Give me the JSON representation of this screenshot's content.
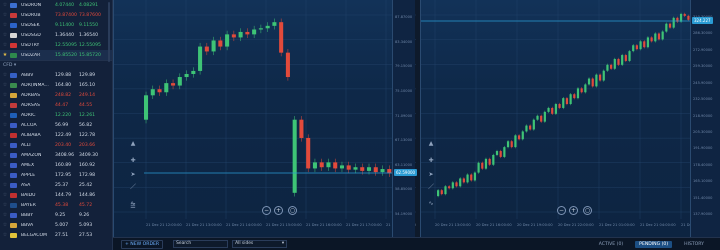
{
  "sidebar": {
    "forex": [
      {
        "sym": "USDRON",
        "bid": "4.07440",
        "ask": "4.08291",
        "dir": "up",
        "flag": "#3c6fd0",
        "fav": false,
        "sel": false
      },
      {
        "sym": "USDRUB",
        "bid": "73.87400",
        "ask": "73.87600",
        "dir": "down",
        "flag": "#c93a3a",
        "fav": false,
        "sel": false
      },
      {
        "sym": "USDSEK",
        "bid": "9.11400",
        "ask": "9.11550",
        "dir": "up",
        "flag": "#2c63c9",
        "fav": false,
        "sel": false
      },
      {
        "sym": "USDSGD",
        "bid": "1.36440",
        "ask": "1.36540",
        "dir": "neutral",
        "flag": "#d6d6d6",
        "fav": false,
        "sel": false
      },
      {
        "sym": "USDTRY",
        "bid": "12.55095",
        "ask": "12.55095",
        "dir": "up",
        "flag": "#d03535",
        "fav": false,
        "sel": false
      },
      {
        "sym": "USDZAR",
        "bid": "15.85520",
        "ask": "15.85720",
        "dir": "up",
        "flag": "#2e8a4d",
        "fav": true,
        "sel": true
      }
    ],
    "cfd_label": "CFD",
    "cfd": [
      {
        "sym": "ABBV",
        "bid": "129.88",
        "ask": "129.89",
        "dir": "neutral",
        "flag": "#3660c4"
      },
      {
        "sym": "ADR(INMA...",
        "bid": "164.80",
        "ask": "165.10",
        "dir": "neutral",
        "flag": "#3a8c4e"
      },
      {
        "sym": "ADRBAS",
        "bid": "248.82",
        "ask": "249.14",
        "dir": "down",
        "flag": "#d4a53a"
      },
      {
        "sym": "ADRSAS",
        "bid": "44.47",
        "ask": "44.55",
        "dir": "down",
        "flag": "#c23b3b"
      },
      {
        "sym": "ADRIC",
        "bid": "12.220",
        "ask": "12.261",
        "dir": "up",
        "flag": "#1f5fb8"
      },
      {
        "sym": "ALCOA",
        "bid": "56.99",
        "ask": "56.82",
        "dir": "neutral",
        "flag": "#3b5cc4"
      },
      {
        "sym": "ALIBABA",
        "bid": "122.49",
        "ask": "122.78",
        "dir": "neutral",
        "flag": "#c13030"
      },
      {
        "sym": "ALLI",
        "bid": "203.40",
        "ask": "203.66",
        "dir": "down",
        "flag": "#3b5cc4"
      },
      {
        "sym": "AMAZON",
        "bid": "3408.96",
        "ask": "3409.30",
        "dir": "neutral",
        "flag": "#3b5cc4"
      },
      {
        "sym": "AMEX",
        "bid": "160.89",
        "ask": "160.92",
        "dir": "neutral",
        "flag": "#3b5cc4"
      },
      {
        "sym": "APPLE",
        "bid": "172.95",
        "ask": "172.98",
        "dir": "neutral",
        "flag": "#3b5cc4"
      },
      {
        "sym": "ASA",
        "bid": "25.37",
        "ask": "25.42",
        "dir": "neutral",
        "flag": "#3b5cc4"
      },
      {
        "sym": "BAIDU",
        "bid": "144.79",
        "ask": "144.86",
        "dir": "neutral",
        "flag": "#c13030"
      },
      {
        "sym": "BAYER",
        "bid": "45.38",
        "ask": "45.72",
        "dir": "down",
        "flag": "#1f4e8c"
      },
      {
        "sym": "BBBY",
        "bid": "9.25",
        "ask": "9.26",
        "dir": "neutral",
        "flag": "#3b5cc4"
      },
      {
        "sym": "BBVA",
        "bid": "5.007",
        "ask": "5.093",
        "dir": "neutral",
        "flag": "#d4a53a"
      },
      {
        "sym": "BELGACOM",
        "bid": "27.51",
        "ask": "27.53",
        "dir": "neutral",
        "flag": "#e0c23a"
      }
    ]
  },
  "chart_data": [
    {
      "type": "candlestick",
      "title": "",
      "y_ticks": [
        "87.87000",
        "83.34000",
        "79.15000",
        "75.10000",
        "71.09000",
        "67.13000",
        "63.11000",
        "58.85000",
        "54.19000"
      ],
      "x_ticks": [
        "21 Dec 21 12:00:00",
        "21 Dec 21 13:00:00",
        "21 Dec 21 14:00:00",
        "21 Dec 21 15:00:00",
        "21 Dec 21 16:00:00",
        "21 Dec 21 17:00:00",
        "21 Dec 21 18:00:00"
      ],
      "price_line": "62.59000",
      "candles": [
        {
          "o": 22,
          "c": 26
        },
        {
          "o": 26,
          "c": 27
        },
        {
          "o": 27,
          "c": 26.5
        },
        {
          "o": 26.5,
          "c": 28
        },
        {
          "o": 28,
          "c": 27.6
        },
        {
          "o": 27.6,
          "c": 29
        },
        {
          "o": 29,
          "c": 29.5
        },
        {
          "o": 29.5,
          "c": 30
        },
        {
          "o": 30,
          "c": 34
        },
        {
          "o": 34,
          "c": 33.2
        },
        {
          "o": 33.2,
          "c": 35
        },
        {
          "o": 35,
          "c": 34
        },
        {
          "o": 34,
          "c": 36
        },
        {
          "o": 36,
          "c": 35.5
        },
        {
          "o": 35.5,
          "c": 36.4
        },
        {
          "o": 36.4,
          "c": 36
        },
        {
          "o": 36,
          "c": 36.8
        },
        {
          "o": 36.8,
          "c": 37
        },
        {
          "o": 37,
          "c": 37.4
        },
        {
          "o": 37.4,
          "c": 38
        },
        {
          "o": 38,
          "c": 33
        },
        {
          "o": 33,
          "c": 29
        },
        {
          "o": 10,
          "c": 22
        },
        {
          "o": 22,
          "c": 19
        },
        {
          "o": 19,
          "c": 14
        },
        {
          "o": 14,
          "c": 15
        },
        {
          "o": 15,
          "c": 14.2
        },
        {
          "o": 14.2,
          "c": 15
        },
        {
          "o": 15,
          "c": 14
        },
        {
          "o": 14,
          "c": 14.5
        },
        {
          "o": 14.5,
          "c": 13.8
        },
        {
          "o": 13.8,
          "c": 14.2
        },
        {
          "o": 14.2,
          "c": 13.6
        },
        {
          "o": 13.6,
          "c": 14.2
        },
        {
          "o": 14.2,
          "c": 13.4
        },
        {
          "o": 13.4,
          "c": 13.9
        },
        {
          "o": 13.9,
          "c": 13.2
        }
      ]
    },
    {
      "type": "candlestick",
      "title": "",
      "y_ticks": [
        "310.30000",
        "286.30000",
        "272.90000",
        "259.30000",
        "245.90000",
        "232.50000",
        "218.90000",
        "205.30000",
        "191.90000",
        "178.40000",
        "165.10000",
        "151.40000",
        "137.90000"
      ],
      "x_ticks": [
        "20 Dec 21 13:00:00",
        "20 Dec 21 16:00:00",
        "20 Dec 21 19:00:00",
        "20 Dec 21 22:00:00",
        "21 Dec 21 01:00:00",
        "21 Dec 21 04:00:00",
        "21 Dec 21 07:00:00"
      ],
      "price_line": "324.227",
      "candles": [
        {
          "o": 5,
          "c": 8
        },
        {
          "o": 8,
          "c": 6
        },
        {
          "o": 6,
          "c": 10
        },
        {
          "o": 10,
          "c": 9
        },
        {
          "o": 9,
          "c": 12
        },
        {
          "o": 12,
          "c": 10
        },
        {
          "o": 10,
          "c": 14
        },
        {
          "o": 14,
          "c": 12
        },
        {
          "o": 12,
          "c": 16
        },
        {
          "o": 16,
          "c": 13
        },
        {
          "o": 13,
          "c": 17
        },
        {
          "o": 17,
          "c": 22
        },
        {
          "o": 22,
          "c": 19
        },
        {
          "o": 19,
          "c": 24
        },
        {
          "o": 24,
          "c": 21
        },
        {
          "o": 21,
          "c": 26
        },
        {
          "o": 26,
          "c": 28
        },
        {
          "o": 28,
          "c": 25
        },
        {
          "o": 25,
          "c": 30
        },
        {
          "o": 30,
          "c": 33
        },
        {
          "o": 33,
          "c": 30
        },
        {
          "o": 30,
          "c": 36
        },
        {
          "o": 36,
          "c": 34
        },
        {
          "o": 34,
          "c": 38
        },
        {
          "o": 38,
          "c": 41
        },
        {
          "o": 41,
          "c": 39
        },
        {
          "o": 39,
          "c": 44
        },
        {
          "o": 44,
          "c": 46
        },
        {
          "o": 46,
          "c": 43
        },
        {
          "o": 43,
          "c": 48
        },
        {
          "o": 48,
          "c": 50
        },
        {
          "o": 50,
          "c": 47
        },
        {
          "o": 47,
          "c": 52
        },
        {
          "o": 52,
          "c": 50
        },
        {
          "o": 50,
          "c": 55
        },
        {
          "o": 55,
          "c": 52
        },
        {
          "o": 52,
          "c": 57
        },
        {
          "o": 57,
          "c": 55
        },
        {
          "o": 55,
          "c": 60
        },
        {
          "o": 60,
          "c": 58
        },
        {
          "o": 58,
          "c": 62
        },
        {
          "o": 62,
          "c": 65
        },
        {
          "o": 65,
          "c": 61
        },
        {
          "o": 61,
          "c": 67
        },
        {
          "o": 67,
          "c": 64
        },
        {
          "o": 64,
          "c": 69
        },
        {
          "o": 69,
          "c": 72
        },
        {
          "o": 72,
          "c": 70
        },
        {
          "o": 70,
          "c": 75
        },
        {
          "o": 75,
          "c": 72
        },
        {
          "o": 72,
          "c": 77
        },
        {
          "o": 77,
          "c": 74
        },
        {
          "o": 74,
          "c": 79
        },
        {
          "o": 79,
          "c": 82
        },
        {
          "o": 82,
          "c": 80
        },
        {
          "o": 80,
          "c": 84
        },
        {
          "o": 84,
          "c": 81
        },
        {
          "o": 81,
          "c": 86
        },
        {
          "o": 86,
          "c": 84
        },
        {
          "o": 84,
          "c": 88
        },
        {
          "o": 88,
          "c": 85
        },
        {
          "o": 85,
          "c": 89
        },
        {
          "o": 89,
          "c": 93
        },
        {
          "o": 93,
          "c": 91
        },
        {
          "o": 91,
          "c": 96
        },
        {
          "o": 96,
          "c": 94
        },
        {
          "o": 94,
          "c": 98
        },
        {
          "o": 98,
          "c": 97
        },
        {
          "o": 97,
          "c": 95
        }
      ]
    }
  ],
  "bottom": {
    "new_order": "+ NEW ORDER",
    "search_placeholder": "Search",
    "sides": "All sides",
    "tabs": [
      "ACTIVE (0)",
      "PENDING (0)",
      "HISTORY"
    ],
    "active_tab": 1
  }
}
